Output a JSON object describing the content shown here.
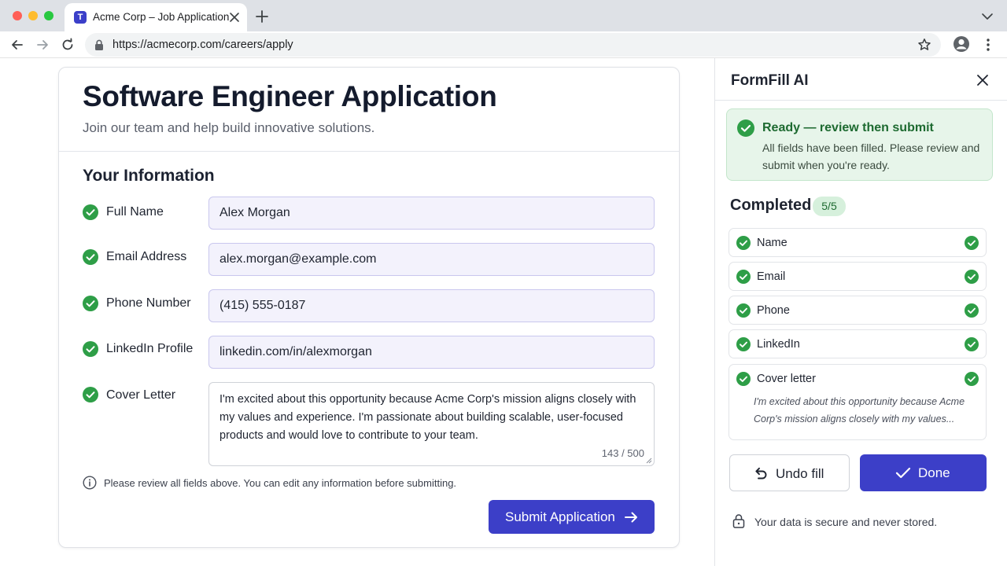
{
  "browser": {
    "tab_title": "Acme Corp – Job Application",
    "url": "https://acmecorp.com/careers/apply",
    "favicon_letter": "T"
  },
  "form": {
    "title": "Software Engineer Application",
    "subtitle": "Join our team and help build innovative solutions.",
    "section_title": "Your Information",
    "fields": [
      {
        "label": "Full Name",
        "value": "Alex Morgan"
      },
      {
        "label": "Email Address",
        "value": "alex.morgan@example.com"
      },
      {
        "label": "Phone Number",
        "value": "(415) 555-0187"
      },
      {
        "label": "LinkedIn Profile",
        "value": "linkedin.com/in/alexmorgan"
      },
      {
        "label": "Cover Letter",
        "value": "I'm excited about this opportunity because Acme Corp's mission aligns closely with my values and experience. I'm passionate about building scalable, user-focused products and would love to contribute to your team."
      }
    ],
    "cover_letter_count": "143 / 500",
    "info_note": "Please review all fields above. You can edit any information before submitting.",
    "submit_label": "Submit Application"
  },
  "panel": {
    "title": "FormFill AI",
    "status_title": "Ready — review then submit",
    "status_desc": "All fields have been filled. Please review and submit when you're ready.",
    "completed_title": "Completed",
    "completed_count": "5/5",
    "items": [
      {
        "label": "Name"
      },
      {
        "label": "Email"
      },
      {
        "label": "Phone"
      },
      {
        "label": "LinkedIn"
      },
      {
        "label": "Cover letter",
        "preview": "I'm excited about this opportunity because Acme Corp's mission aligns closely with my values..."
      }
    ],
    "undo_label": "Undo fill",
    "done_label": "Done",
    "secure_note": "Your data is secure and never stored."
  },
  "colors": {
    "accent": "#3c3fc8",
    "success": "#2e9e47",
    "success_bg": "#e7f5ea",
    "input_bg": "#f3f2fc"
  },
  "icons": [
    "back-icon",
    "forward-icon",
    "reload-icon",
    "lock-icon",
    "star-icon",
    "profile-icon",
    "menu-icon",
    "close-icon",
    "check-circle-icon",
    "info-icon",
    "arrow-right-icon",
    "undo-icon",
    "checkmark-icon",
    "padlock-icon"
  ]
}
